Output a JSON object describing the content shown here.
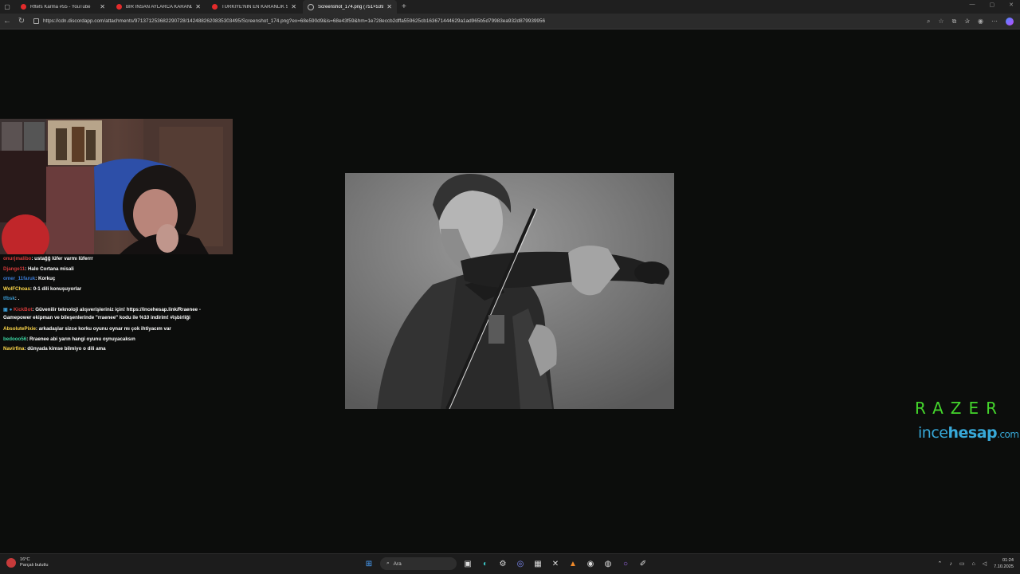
{
  "browser": {
    "tabs": [
      {
        "title": "Rftefs Karma #55 - YouTube",
        "type": "youtube"
      },
      {
        "title": "BİR İNSAN AYLARCA KARANLIK İ",
        "type": "youtube"
      },
      {
        "title": "TÜRKİYE'NİN EN KARANLIK SERİ",
        "type": "youtube"
      },
      {
        "title": "Screenshot_174.png (751×539)",
        "type": "globe",
        "active": true
      }
    ],
    "url": "https://cdn.discordapp.com/attachments/971371253682290728/1424882620835303495/Screenshot_174.png?ex=68e590d9&is=68e43f59&hm=1e728eccb2dffa559625cb163671444629a1ad965b5d79983ea932d879939956"
  },
  "chat": {
    "messages": [
      {
        "user": "onurjmalibo",
        "color": "#d23a3a",
        "text": ": ustağğ lüfer varmı lüferrr"
      },
      {
        "user": "Djange11",
        "color": "#d23a3a",
        "text": ": Halo Cortana misali"
      },
      {
        "user": "omer_11faruk",
        "color": "#3a79d2",
        "text": ": Korkuç"
      },
      {
        "user": "WolFChoas",
        "color": "#ffd84a",
        "text": ": 0-1 dili konuşuyorlar"
      },
      {
        "user": "tfbsk",
        "color": "#3a9ad2",
        "text": ": ."
      },
      {
        "user": "KickBot",
        "color": "#d23a3a",
        "text": ": Güvenilir teknoloji alışverişleriniz için! https://incehesap.link/Rraenee - Gamepower ekipman ve bileşenlerinde \"rraenee\" kodu ile %10 indirim! #işbirliği"
      },
      {
        "user": "AbsolutePixie",
        "color": "#ffd84a",
        "text": ": arkadaşlar sizce korku oyunu oynar mı çok ihtiyacım var"
      },
      {
        "user": "bedooo56",
        "color": "#3ad2a0",
        "text": ": Rraenee abi yarın hangi oyunu oynuyacaksın"
      },
      {
        "user": "Navirfina",
        "color": "#ffd84a",
        "text": ": dünyada kimse bilmiyo o dili ama"
      }
    ]
  },
  "brand": {
    "razer": "RAZER",
    "ince_part1": "ince",
    "ince_part2": "hesap",
    "ince_part3": ".com"
  },
  "taskbar": {
    "weather_temp": "16°C",
    "weather_desc": "Parçalı bulutlu",
    "search_placeholder": "Ara",
    "time": "01:24",
    "date": "7.10.2025"
  }
}
